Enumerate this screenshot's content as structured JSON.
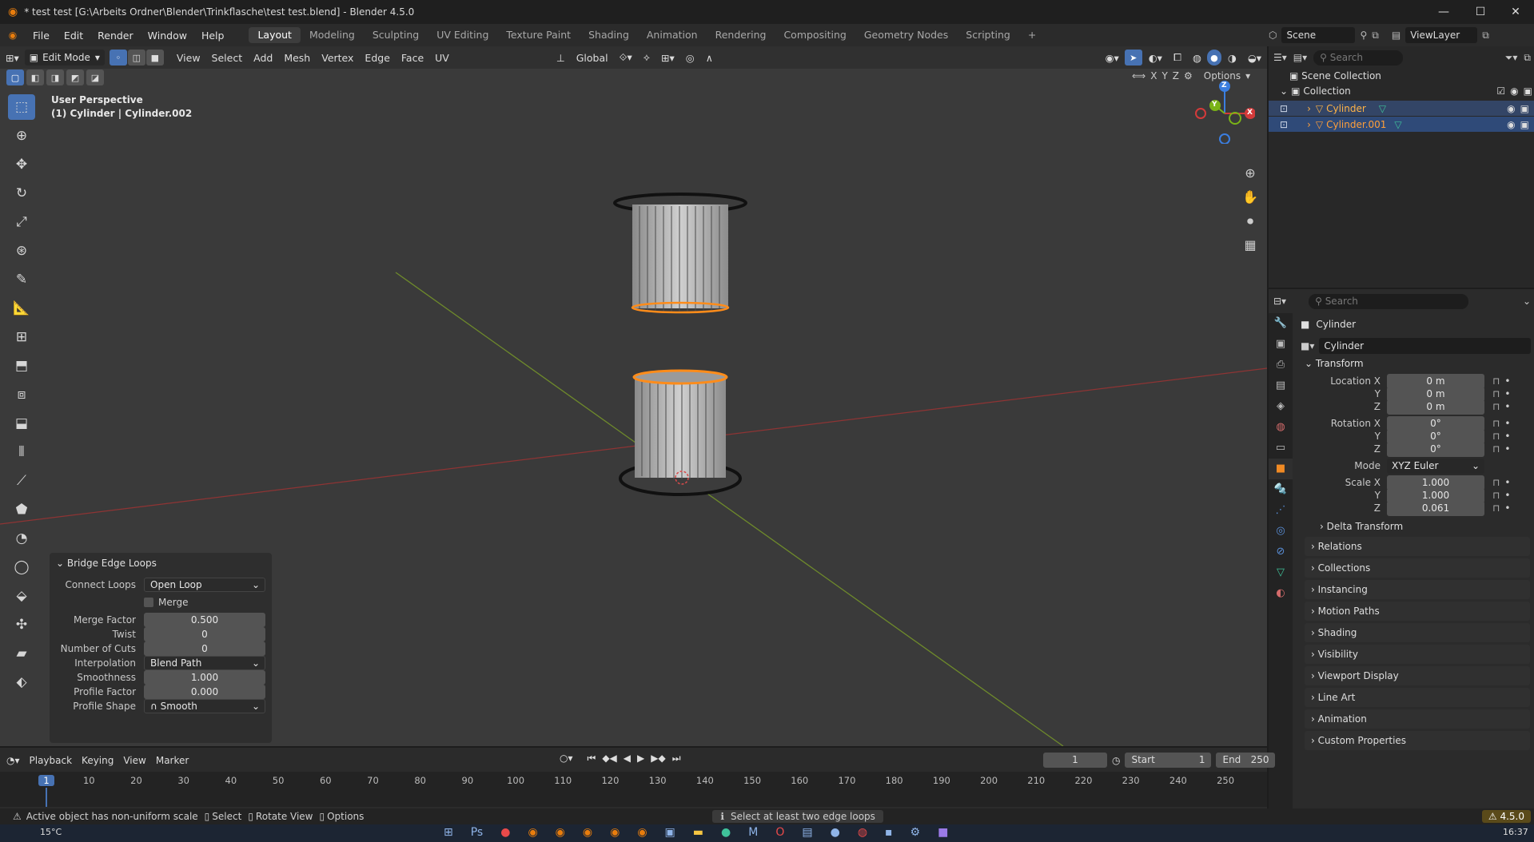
{
  "window": {
    "title": "* test test [G:\\Arbeits Ordner\\Blender\\Trinkflasche\\test test.blend] - Blender 4.5.0"
  },
  "menu": {
    "items": [
      "File",
      "Edit",
      "Render",
      "Window",
      "Help"
    ]
  },
  "workspaces": {
    "tabs": [
      "Layout",
      "Modeling",
      "Sculpting",
      "UV Editing",
      "Texture Paint",
      "Shading",
      "Animation",
      "Rendering",
      "Compositing",
      "Geometry Nodes",
      "Scripting"
    ],
    "active": "Layout"
  },
  "scene": {
    "name": "Scene",
    "view_layer": "ViewLayer"
  },
  "viewport_header": {
    "mode": "Edit Mode",
    "menus": [
      "View",
      "Select",
      "Add",
      "Mesh",
      "Vertex",
      "Edge",
      "Face",
      "UV"
    ],
    "orientation": "Global",
    "options": "Options",
    "axes": [
      "X",
      "Y",
      "Z"
    ]
  },
  "viewport": {
    "perspective": "User Perspective",
    "object_info": "(1) Cylinder | Cylinder.002",
    "gizmo": {
      "x": "X",
      "y": "Y",
      "z": "Z"
    }
  },
  "bridge_panel": {
    "title": "Bridge Edge Loops",
    "connect_loops_label": "Connect Loops",
    "connect_loops": "Open Loop",
    "merge_label": "Merge",
    "merge_factor_label": "Merge Factor",
    "merge_factor": "0.500",
    "twist_label": "Twist",
    "twist": "0",
    "cuts_label": "Number of Cuts",
    "cuts": "0",
    "interpolation_label": "Interpolation",
    "interpolation": "Blend Path",
    "smoothness_label": "Smoothness",
    "smoothness": "1.000",
    "profile_factor_label": "Profile Factor",
    "profile_factor": "0.000",
    "profile_shape_label": "Profile Shape",
    "profile_shape": "Smooth"
  },
  "outliner": {
    "search_placeholder": "Search",
    "scene_collection": "Scene Collection",
    "collection": "Collection",
    "objects": [
      "Cylinder",
      "Cylinder.001"
    ]
  },
  "properties": {
    "search_placeholder": "Search",
    "object_name": "Cylinder",
    "data_name": "Cylinder",
    "transform": "Transform",
    "location_x_label": "Location X",
    "location_x": "0 m",
    "location_y_label": "Y",
    "location_y": "0 m",
    "location_z_label": "Z",
    "location_z": "0 m",
    "rotation_x_label": "Rotation X",
    "rotation_x": "0°",
    "rotation_y_label": "Y",
    "rotation_y": "0°",
    "rotation_z_label": "Z",
    "rotation_z": "0°",
    "mode_label": "Mode",
    "mode": "XYZ Euler",
    "scale_x_label": "Scale X",
    "scale_x": "1.000",
    "scale_y_label": "Y",
    "scale_y": "1.000",
    "scale_z_label": "Z",
    "scale_z": "0.061",
    "delta_transform": "Delta Transform",
    "panels": [
      "Relations",
      "Collections",
      "Instancing",
      "Motion Paths",
      "Shading",
      "Visibility",
      "Viewport Display",
      "Line Art",
      "Animation",
      "Custom Properties"
    ]
  },
  "timeline": {
    "menus": [
      "Playback",
      "Keying",
      "View",
      "Marker"
    ],
    "current_frame": "1",
    "start_label": "Start",
    "start": "1",
    "end_label": "End",
    "end": "250",
    "ticks": [
      "1",
      "10",
      "20",
      "30",
      "40",
      "50",
      "60",
      "70",
      "80",
      "90",
      "100",
      "110",
      "120",
      "130",
      "140",
      "150",
      "160",
      "170",
      "180",
      "190",
      "200",
      "210",
      "220",
      "230",
      "240",
      "250"
    ]
  },
  "status": {
    "warning": "Active object has non-uniform scale",
    "select": "Select",
    "rotate": "Rotate View",
    "options": "Options",
    "message": "Select at least two edge loops",
    "version": "4.5.0"
  },
  "taskbar": {
    "weather": "15°C",
    "time": "16:37"
  },
  "colors": {
    "accent": "#4772b3",
    "selection": "#ff8c1a",
    "x_axis": "#d43a3a",
    "y_axis": "#7ab317",
    "z_axis": "#3b7ee0"
  }
}
